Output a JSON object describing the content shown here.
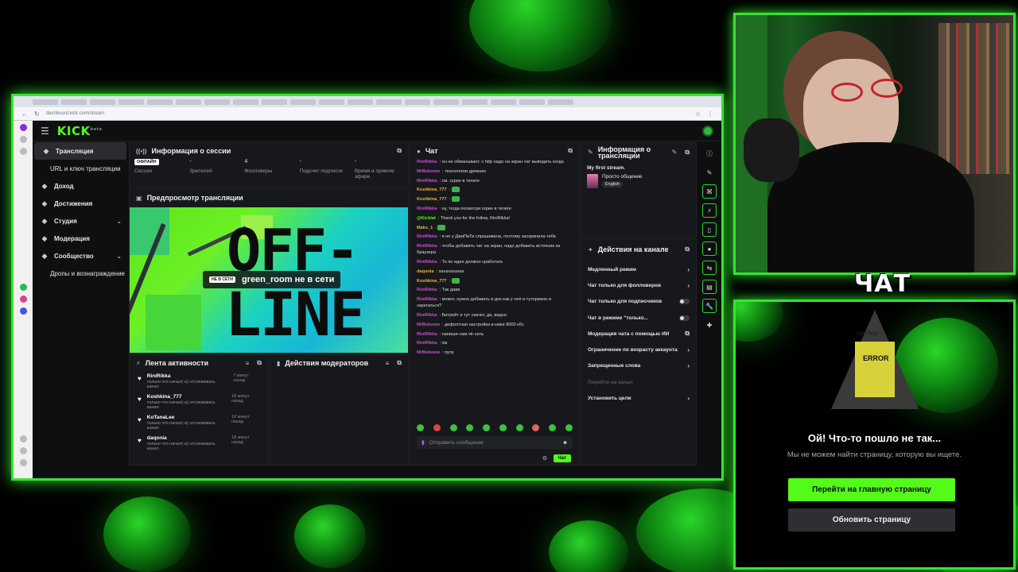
{
  "browser": {
    "url": "dashboard.kick.com/stream"
  },
  "kick": {
    "logo": "KICK",
    "logo_sup": "beta",
    "sidebar": [
      {
        "label": "Трансляция",
        "icon": "broadcast-icon",
        "active": true
      },
      {
        "label": "URL и ключ трансляции",
        "sub": true
      },
      {
        "label": "Доход",
        "icon": "money-icon"
      },
      {
        "label": "Достижения",
        "icon": "trophy-icon"
      },
      {
        "label": "Студия",
        "icon": "studio-icon",
        "chevron": true
      },
      {
        "label": "Модерация",
        "icon": "sword-icon"
      },
      {
        "label": "Сообщество",
        "icon": "community-icon",
        "chevron": true
      },
      {
        "label": "Дропы и вознаграждение",
        "sub": true
      }
    ],
    "session": {
      "title": "Информация о сессии",
      "stats": [
        {
          "value": "ОФЛАЙН",
          "label": "Сессия"
        },
        {
          "value": "-",
          "label": "Зрителей"
        },
        {
          "value": "4",
          "label": "Фолловеры"
        },
        {
          "value": "-",
          "label": "Подсчет подписок"
        },
        {
          "value": "-",
          "label": "Время в прямом эфире"
        }
      ]
    },
    "preview": {
      "title": "Предпросмотр трансляции",
      "big_text_1": "OFF-",
      "big_text_2": "LINE",
      "badge": "НЕ В СЕТИ",
      "status": "green_room не в сети"
    },
    "activity": {
      "title": "Лента активности",
      "items": [
        {
          "name": "RiniRikka",
          "sub": "только что начал(-а) отслеживать канал",
          "time": "7 минут назад"
        },
        {
          "name": "Koshkina_777",
          "sub": "только что начал(-а) отслеживать канал",
          "time": "18 минут назад"
        },
        {
          "name": "KoTanaLee",
          "sub": "только что начал(-а) отслеживать канал",
          "time": "18 минут назад"
        },
        {
          "name": "daqonia",
          "sub": "только что начал(-а) отслеживать канал",
          "time": "18 минут назад"
        }
      ]
    },
    "mod_actions": {
      "title": "Действия модераторов"
    },
    "chat": {
      "title": "Чат",
      "messages": [
        {
          "user": "RiniRikka",
          "color": "#d34ad8",
          "text": "он не обманывает. с http надо на экран чат выводить когда"
        },
        {
          "user": "MrBoboow",
          "color": "#d34ad8",
          "text": "технологии древних"
        },
        {
          "user": "RiniRikka",
          "color": "#d34ad8",
          "text": "см. скрин в телеге"
        },
        {
          "user": "Koshkina_777",
          "color": "#f0b52e",
          "text": ""
        },
        {
          "user": "Koshkina_777",
          "color": "#f0b52e",
          "text": ""
        },
        {
          "user": "RiniRikka",
          "color": "#d34ad8",
          "text": "ну, тогда посмотри скрин в телеге"
        },
        {
          "user": "@Kicklet",
          "color": "#53fc18",
          "text": "Thank you for the follow, RiniRikka!"
        },
        {
          "user": "Maks_1",
          "color": "#f0b52e",
          "text": ""
        },
        {
          "user": "RiniRikka",
          "color": "#d34ad8",
          "text": "я не у ДжиПиТи спрашивала, поэтому заскринила тебе"
        },
        {
          "user": "RiniRikka",
          "color": "#d34ad8",
          "text": "чтобы добавить чат на экран, надо добавить источник из браузера"
        },
        {
          "user": "RiniRikka",
          "color": "#d34ad8",
          "text": "То по идее должно сработать"
        },
        {
          "user": "daqonia",
          "color": "#f0b52e",
          "text": "хахахахахах"
        },
        {
          "user": "Koshkina_777",
          "color": "#f0b52e",
          "text": ""
        },
        {
          "user": "RiniRikka",
          "color": "#d34ad8",
          "text": "Так давв"
        },
        {
          "user": "RiniRikka",
          "color": "#d34ad8",
          "text": "может, нужно добавить в док как у неё в туториале и зарегаться?"
        },
        {
          "user": "RiniRikka",
          "color": "#d34ad8",
          "text": "Битрейт и тут скачет, да, видно"
        },
        {
          "user": "MrBoboow",
          "color": "#d34ad8",
          "text": "дефолтная настройка в киже 8000 кбс"
        },
        {
          "user": "RiniRikka",
          "color": "#d34ad8",
          "text": "напиши нам чё-нить"
        },
        {
          "user": "RiniRikka",
          "color": "#d34ad8",
          "text": "хм"
        },
        {
          "user": "MrBoboow",
          "color": "#d34ad8",
          "text": "пупу"
        }
      ],
      "placeholder": "Отправить сообщение",
      "send": "Чат"
    },
    "stream_info": {
      "title": "Информация о трансляции",
      "stream_title": "My first stream.",
      "category": "Просто общение",
      "language": "English"
    },
    "channel_actions": {
      "title": "Действия на канале",
      "rows": [
        {
          "label": "Медленный режим",
          "kind": "chevron"
        },
        {
          "label": "Чат только для фолловеров",
          "kind": "chevron"
        },
        {
          "label": "Чат только для подписчиков",
          "kind": "toggle"
        },
        {
          "label": "Чат в режиме \"только...",
          "kind": "toggle"
        },
        {
          "label": "Модерация чата с помощью ИИ",
          "kind": "external"
        },
        {
          "label": "Ограничение по возрасту аккаунта",
          "kind": "chevron"
        },
        {
          "label": "Запрещенные слова",
          "kind": "chevron"
        },
        {
          "label": "Перейти на канал",
          "kind": "disabled"
        },
        {
          "label": "Установить цели",
          "kind": "chevron"
        }
      ]
    }
  },
  "overlay": {
    "chat_title": "ЧАТ",
    "error_title": "Ой! Что-то пошло не так...",
    "error_sub": "Мы не можем найти страницу, которую вы ищете.",
    "btn_home": "Перейти на главную страницу",
    "btn_refresh": "Обновить страницу",
    "sign_words": [
      "CAUTION",
      "ERROR"
    ]
  },
  "colors": {
    "accent": "#53fc18",
    "frame": "#35e52f"
  }
}
